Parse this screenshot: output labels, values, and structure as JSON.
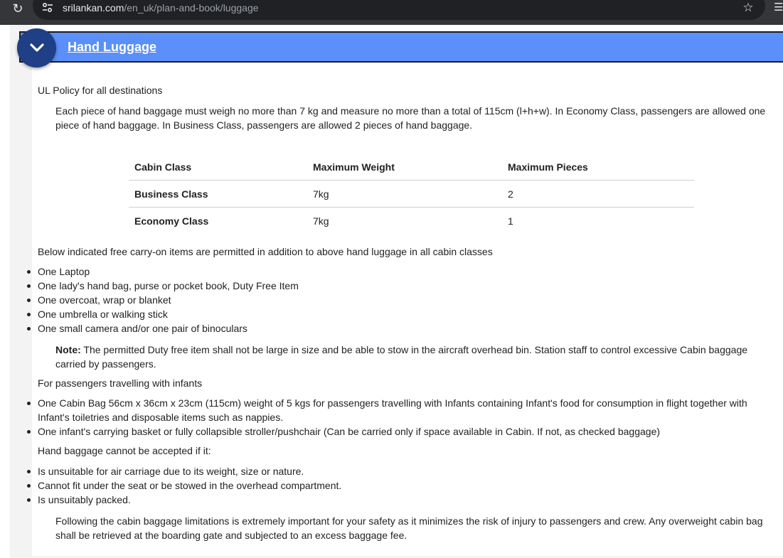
{
  "browser": {
    "url_host": "srilankan.com",
    "url_path": "/en_uk/plan-and-book/luggage"
  },
  "accordion": {
    "title": "Hand Luggage"
  },
  "content": {
    "policy_heading": "UL Policy for all destinations",
    "policy_text": "Each piece of hand baggage must weigh no more than 7 kg and measure no more than a total of 115cm (l+h+w). In Economy Class, passengers are allowed one piece of hand baggage. In Business Class, passengers are allowed 2 pieces of hand baggage.",
    "table": {
      "headers": [
        "Cabin Class",
        "Maximum Weight",
        "Maximum Pieces"
      ],
      "rows": [
        [
          "Business Class",
          "7kg",
          "2"
        ],
        [
          "Economy Class",
          "7kg",
          "1"
        ]
      ]
    },
    "carry_on_intro": "Below indicated free carry-on items are permitted in addition to above hand luggage in all cabin classes",
    "carry_on_items": [
      "One Laptop",
      "One lady's hand bag, purse or pocket book, Duty Free Item",
      "One overcoat, wrap or blanket",
      "One umbrella or walking stick",
      "One small camera and/or one pair of binoculars"
    ],
    "note_label": "Note:",
    "note_text": " The permitted Duty free item shall not be large in size and be able to stow in the aircraft overhead bin. Station staff to control excessive Cabin baggage carried by passengers.",
    "infants_heading": "For passengers travelling with infants",
    "infant_items": [
      "One Cabin Bag 56cm x 36cm x 23cm (115cm) weight of 5 kgs for passengers travelling with Infants containing Infant's food for consumption in flight together with Infant's toiletries and disposable items such as nappies.",
      "One infant's carrying basket or fully collapsible stroller/pushchair (Can be carried only if space available in Cabin. If not, as checked baggage)"
    ],
    "reject_heading": "Hand baggage cannot be accepted if it:",
    "reject_items": [
      "Is unsuitable for air carriage due to its weight, size or nature.",
      "Cannot fit under the seat or be stowed in the overhead compartment.",
      "Is unsuitably packed."
    ],
    "closing_text": "Following the cabin baggage limitations is extremely important for your safety as it minimizes the risk of injury to passengers and crew. Any overweight cabin bag shall be retrieved at the boarding gate and subjected to an excess baggage fee."
  },
  "icons": {
    "reload": "reload-icon",
    "site_settings": "tune-icon",
    "bookmark": "star-icon",
    "toggle": "chevron-down-icon"
  },
  "colors": {
    "accordion_bar": "#5b8ff9",
    "toggle_circle": "#1f3f86",
    "chrome": "#35363a"
  }
}
